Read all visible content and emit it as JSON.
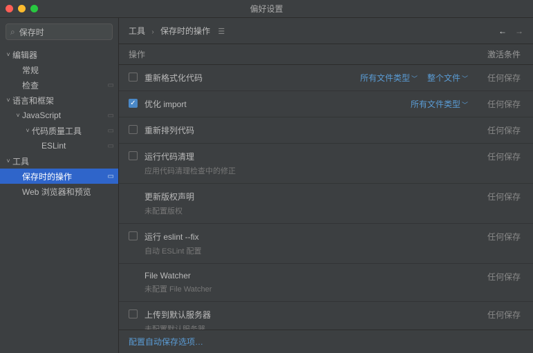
{
  "window": {
    "title": "偏好设置"
  },
  "search": {
    "value": "保存时"
  },
  "tree": [
    {
      "label": "编辑器",
      "depth": 0,
      "arrow": "down"
    },
    {
      "label": "常规",
      "depth": 1
    },
    {
      "label": "检查",
      "depth": 1,
      "badge": true
    },
    {
      "label": "语言和框架",
      "depth": 0,
      "arrow": "down"
    },
    {
      "label": "JavaScript",
      "depth": 1,
      "arrow": "down",
      "badge": true
    },
    {
      "label": "代码质量工具",
      "depth": 2,
      "arrow": "down",
      "badge": true
    },
    {
      "label": "ESLint",
      "depth": 3,
      "badge": true
    },
    {
      "label": "工具",
      "depth": 0,
      "arrow": "down"
    },
    {
      "label": "保存时的操作",
      "depth": 1,
      "badge": true,
      "selected": true
    },
    {
      "label": "Web 浏览器和预览",
      "depth": 1
    }
  ],
  "breadcrumb": {
    "root": "工具",
    "leaf": "保存时的操作"
  },
  "columns": {
    "action": "操作",
    "cond": "激活条件"
  },
  "rows": [
    {
      "checked": false,
      "title": "重新格式化代码",
      "options": [
        "所有文件类型",
        "整个文件"
      ],
      "cond": "任何保存"
    },
    {
      "checked": true,
      "title": "优化 import",
      "options": [
        "所有文件类型"
      ],
      "cond": "任何保存"
    },
    {
      "checked": false,
      "title": "重新排列代码",
      "cond": "任何保存"
    },
    {
      "checked": false,
      "title": "运行代码清理",
      "sub": "应用代码清理检查中的修正",
      "cond": "任何保存"
    },
    {
      "nocb": true,
      "title": "更新版权声明",
      "sub": "未配置版权",
      "cond": "任何保存"
    },
    {
      "checked": false,
      "title": "运行 eslint --fix",
      "sub": "自动 ESLint 配置",
      "cond": "任何保存"
    },
    {
      "nocb": true,
      "title": "File Watcher",
      "sub": "未配置 File Watcher",
      "cond": "任何保存"
    },
    {
      "checked": false,
      "title": "上传到默认服务器",
      "sub": "未配置默认服务器",
      "cond": "任何保存"
    }
  ],
  "footer": {
    "link": "配置自动保存选项…"
  }
}
